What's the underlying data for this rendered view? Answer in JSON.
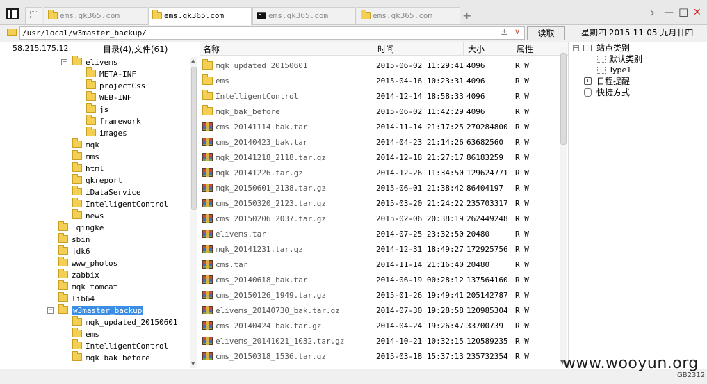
{
  "tabs": [
    {
      "label": "ems.qk365.com",
      "icon": "folder-icon",
      "active": false
    },
    {
      "label": "ems.qk365.com",
      "icon": "folder-icon",
      "active": true
    },
    {
      "label": "ems.qk365.com",
      "icon": "terminal-icon",
      "active": false
    },
    {
      "label": "ems.qk365.com",
      "icon": "folder-icon",
      "active": false
    }
  ],
  "tabbar": {
    "add": "+",
    "next": "›",
    "min": "—",
    "max": "□",
    "close": "✕"
  },
  "path": {
    "value": "/usr/local/w3master_backup/",
    "plusminus": "±",
    "dropdown": "∨",
    "read_button": "读取"
  },
  "date": "星期四 2015-11-05 九月廿四",
  "left": {
    "ip": "58.215.175.12",
    "dircount": "目录(4),文件(61)",
    "tree": [
      {
        "label": "elivems",
        "level": 3,
        "exp": "−"
      },
      {
        "label": "META-INF",
        "level": 4
      },
      {
        "label": "projectCss",
        "level": 4
      },
      {
        "label": "WEB-INF",
        "level": 4
      },
      {
        "label": "js",
        "level": 4
      },
      {
        "label": "framework",
        "level": 4
      },
      {
        "label": "images",
        "level": 4
      },
      {
        "label": "mqk",
        "level": 3
      },
      {
        "label": "mms",
        "level": 3
      },
      {
        "label": "html",
        "level": 3
      },
      {
        "label": "qkreport",
        "level": 3
      },
      {
        "label": "iDataService",
        "level": 3
      },
      {
        "label": "IntelligentControl",
        "level": 3
      },
      {
        "label": "news",
        "level": 3
      },
      {
        "label": "_qingke_",
        "level": 2
      },
      {
        "label": "sbin",
        "level": 2
      },
      {
        "label": "jdk6",
        "level": 2
      },
      {
        "label": "www_photos",
        "level": 2
      },
      {
        "label": "zabbix",
        "level": 2
      },
      {
        "label": "mqk_tomcat",
        "level": 2
      },
      {
        "label": "lib64",
        "level": 2
      },
      {
        "label": "w3master_backup",
        "level": 2,
        "exp": "−",
        "selected": true
      },
      {
        "label": "mqk_updated_20150601",
        "level": 3
      },
      {
        "label": "ems",
        "level": 3
      },
      {
        "label": "IntelligentControl",
        "level": 3
      },
      {
        "label": "mqk_bak_before",
        "level": 3
      }
    ]
  },
  "table": {
    "headers": {
      "name": "名称",
      "time": "时间",
      "size": "大小",
      "attr": "属性"
    },
    "rows": [
      {
        "icon": "folder",
        "name": "mqk_updated_20150601",
        "time": "2015-06-02 11:29:41",
        "size": "4096",
        "attr": "R W"
      },
      {
        "icon": "folder",
        "name": "ems",
        "time": "2015-04-16 10:23:31",
        "size": "4096",
        "attr": "R W"
      },
      {
        "icon": "folder",
        "name": "IntelligentControl",
        "time": "2014-12-14 18:58:33",
        "size": "4096",
        "attr": "R W"
      },
      {
        "icon": "folder",
        "name": "mqk_bak_before",
        "time": "2015-06-02 11:42:29",
        "size": "4096",
        "attr": "R W"
      },
      {
        "icon": "archive",
        "name": "cms_20141114_bak.tar",
        "time": "2014-11-14 21:17:25",
        "size": "270284800",
        "attr": "R W"
      },
      {
        "icon": "archive",
        "name": "cms_20140423_bak.tar",
        "time": "2014-04-23 21:14:26",
        "size": "63682560",
        "attr": "R W"
      },
      {
        "icon": "archive",
        "name": "mqk_20141218_2118.tar.gz",
        "time": "2014-12-18 21:27:17",
        "size": "86183259",
        "attr": "R W"
      },
      {
        "icon": "archive",
        "name": "mqk_20141226.tar.gz",
        "time": "2014-12-26 11:34:50",
        "size": "129624771",
        "attr": "R W"
      },
      {
        "icon": "archive",
        "name": "mqk_20150601_2138.tar.gz",
        "time": "2015-06-01 21:38:42",
        "size": "86404197",
        "attr": "R W"
      },
      {
        "icon": "archive",
        "name": "cms_20150320_2123.tar.gz",
        "time": "2015-03-20 21:24:22",
        "size": "235703317",
        "attr": "R W"
      },
      {
        "icon": "archive",
        "name": "cms_20150206_2037.tar.gz",
        "time": "2015-02-06 20:38:19",
        "size": "262449248",
        "attr": "R W"
      },
      {
        "icon": "archive",
        "name": "elivems.tar",
        "time": "2014-07-25 23:32:50",
        "size": "20480",
        "attr": "R W"
      },
      {
        "icon": "archive",
        "name": "mqk_20141231.tar.gz",
        "time": "2014-12-31 18:49:27",
        "size": "172925756",
        "attr": "R W"
      },
      {
        "icon": "archive",
        "name": "cms.tar",
        "time": "2014-11-14 21:16:40",
        "size": "20480",
        "attr": "R W"
      },
      {
        "icon": "archive",
        "name": "cms_20140618_bak.tar",
        "time": "2014-06-19 00:28:12",
        "size": "137564160",
        "attr": "R W"
      },
      {
        "icon": "archive",
        "name": "cms_20150126_1949.tar.gz",
        "time": "2015-01-26 19:49:41",
        "size": "205142787",
        "attr": "R W"
      },
      {
        "icon": "archive",
        "name": "elivems_20140730_bak.tar.gz",
        "time": "2014-07-30 19:28:58",
        "size": "120985304",
        "attr": "R W"
      },
      {
        "icon": "archive",
        "name": "cms_20140424_bak.tar.gz",
        "time": "2014-04-24 19:26:47",
        "size": "33700739",
        "attr": "R W"
      },
      {
        "icon": "archive",
        "name": "elivems_20141021_1032.tar.gz",
        "time": "2014-10-21 10:32:15",
        "size": "120589235",
        "attr": "R W"
      },
      {
        "icon": "archive",
        "name": "cms_20150318_1536.tar.gz",
        "time": "2015-03-18 15:37:13",
        "size": "235732354",
        "attr": "R W"
      }
    ]
  },
  "right": {
    "site_category": "站点类别",
    "default_category": "默认类别",
    "type1": "Type1",
    "schedule": "日程提醒",
    "shortcut": "快捷方式"
  },
  "footer": {
    "watermark": "www.wooyun.org",
    "encoding": "GB2312"
  },
  "colors": {
    "selection": "#3a8ee6",
    "folder": "#f3d055",
    "close": "#d02020"
  }
}
